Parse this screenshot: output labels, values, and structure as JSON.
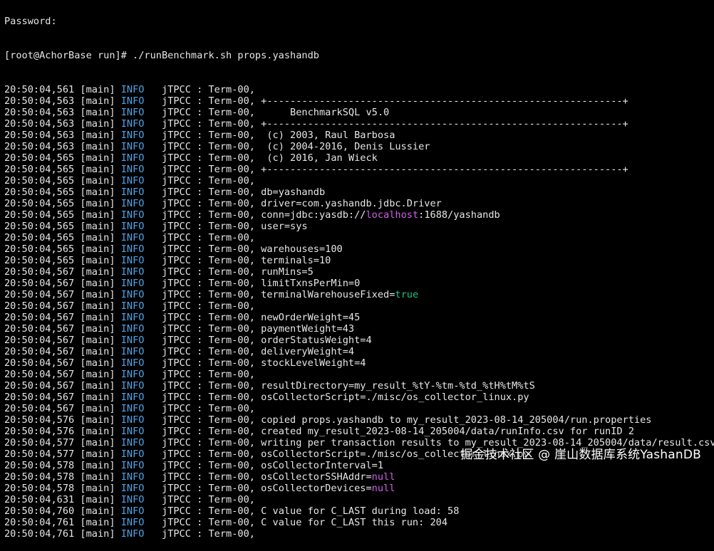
{
  "terminal": {
    "top_partial": "Password:",
    "prompt": "[root@AchorBase run]# ./runBenchmark.sh props.yashandb",
    "lines": [
      {
        "time": "20:50:04,561",
        "msg": ""
      },
      {
        "time": "20:50:04,563",
        "msg": "+-------------------------------------------------------------+"
      },
      {
        "time": "20:50:04,563",
        "msg": "     BenchmarkSQL v5.0"
      },
      {
        "time": "20:50:04,563",
        "msg": "+-------------------------------------------------------------+"
      },
      {
        "time": "20:50:04,563",
        "msg": " (c) 2003, Raul Barbosa"
      },
      {
        "time": "20:50:04,563",
        "msg": " (c) 2004-2016, Denis Lussier"
      },
      {
        "time": "20:50:04,565",
        "msg": " (c) 2016, Jan Wieck"
      },
      {
        "time": "20:50:04,565",
        "msg": "+-------------------------------------------------------------+"
      },
      {
        "time": "20:50:04,565",
        "msg": ""
      },
      {
        "time": "20:50:04,565",
        "msg": "db=yashandb"
      },
      {
        "time": "20:50:04,565",
        "msg": "driver=com.yashandb.jdbc.Driver"
      },
      {
        "time": "20:50:04,565",
        "msg": "conn=jdbc:yasdb://",
        "hl": "localhost",
        "hl_type": "host",
        "after": ":1688/yashandb"
      },
      {
        "time": "20:50:04,565",
        "msg": "user=sys"
      },
      {
        "time": "20:50:04,565",
        "msg": ""
      },
      {
        "time": "20:50:04,565",
        "msg": "warehouses=100"
      },
      {
        "time": "20:50:04,565",
        "msg": "terminals=10"
      },
      {
        "time": "20:50:04,567",
        "msg": "runMins=5"
      },
      {
        "time": "20:50:04,567",
        "msg": "limitTxnsPerMin=0"
      },
      {
        "time": "20:50:04,567",
        "msg": "terminalWarehouseFixed=",
        "hl": "true",
        "hl_type": "true",
        "after": ""
      },
      {
        "time": "20:50:04,567",
        "msg": ""
      },
      {
        "time": "20:50:04,567",
        "msg": "newOrderWeight=45"
      },
      {
        "time": "20:50:04,567",
        "msg": "paymentWeight=43"
      },
      {
        "time": "20:50:04,567",
        "msg": "orderStatusWeight=4"
      },
      {
        "time": "20:50:04,567",
        "msg": "deliveryWeight=4"
      },
      {
        "time": "20:50:04,567",
        "msg": "stockLevelWeight=4"
      },
      {
        "time": "20:50:04,567",
        "msg": ""
      },
      {
        "time": "20:50:04,567",
        "msg": "resultDirectory=my_result_%tY-%tm-%td_%tH%tM%tS"
      },
      {
        "time": "20:50:04,567",
        "msg": "osCollectorScript=./misc/os_collector_linux.py"
      },
      {
        "time": "20:50:04,567",
        "msg": ""
      },
      {
        "time": "20:50:04,576",
        "msg": "copied props.yashandb to my_result_2023-08-14_205004/run.properties"
      },
      {
        "time": "20:50:04,576",
        "msg": "created my_result_2023-08-14_205004/data/runInfo.csv for runID 2"
      },
      {
        "time": "20:50:04,577",
        "msg": "writing per transaction results to my_result_2023-08-14_205004/data/result.csv"
      },
      {
        "time": "20:50:04,577",
        "msg": "osCollectorScript=./misc/os_collector_linux.py"
      },
      {
        "time": "20:50:04,578",
        "msg": "osCollectorInterval=1"
      },
      {
        "time": "20:50:04,578",
        "msg": "osCollectorSSHAddr=",
        "hl": "null",
        "hl_type": "null",
        "after": ""
      },
      {
        "time": "20:50:04,578",
        "msg": "osCollectorDevices=",
        "hl": "null",
        "hl_type": "null",
        "after": ""
      },
      {
        "time": "20:50:04,631",
        "msg": ""
      },
      {
        "time": "20:50:04,760",
        "msg": "C value for C_LAST during load: 58"
      },
      {
        "time": "20:50:04,761",
        "msg": "C value for C_LAST this run: 204"
      },
      {
        "time": "20:50:04,761",
        "msg": ""
      }
    ],
    "thread": "[main]",
    "level": "INFO",
    "logger": "jTPCC : Term-00,"
  },
  "watermark": "掘金技术社区 @ 崖山数据库系统YashanDB",
  "colors": {
    "background": "#000000",
    "text": "#e6e6e6",
    "info": "#4fa3e6",
    "true": "#19c48a",
    "null": "#d060e8"
  }
}
